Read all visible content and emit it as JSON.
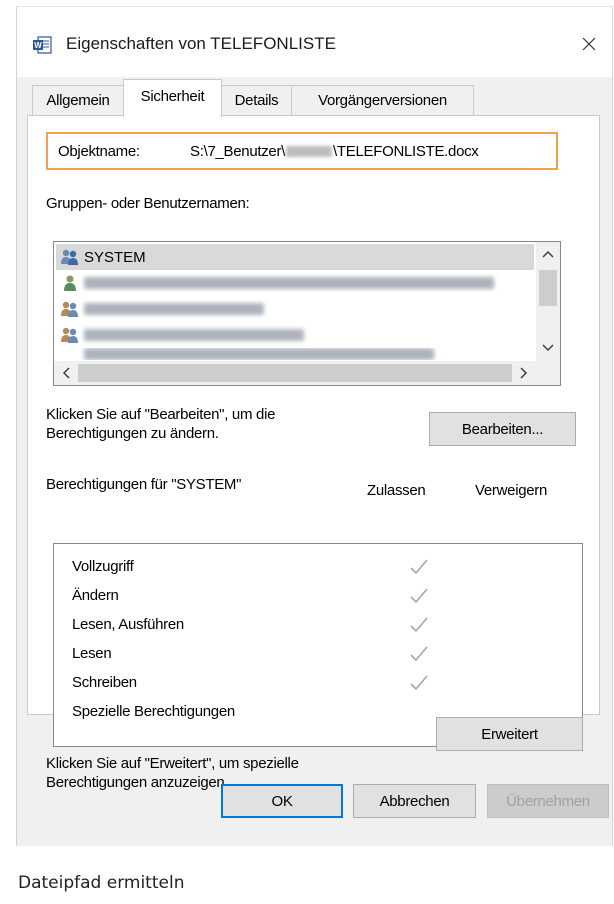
{
  "window": {
    "title": "Eigenschaften von TELEFONLISTE",
    "app_icon": "word-document-icon",
    "close_icon": "close-icon"
  },
  "tabs": [
    {
      "label": "Allgemein",
      "active": false
    },
    {
      "label": "Sicherheit",
      "active": true
    },
    {
      "label": "Details",
      "active": false
    },
    {
      "label": "Vorgängerversionen",
      "active": false
    }
  ],
  "object": {
    "label": "Objektname:",
    "path_prefix": "S:\\7_Benutzer\\",
    "path_suffix": "\\TELEFONLISTE.docx"
  },
  "groups": {
    "label": "Gruppen- oder Benutzernamen:",
    "items": [
      {
        "name": "SYSTEM",
        "selected": true
      }
    ]
  },
  "edit": {
    "text_line1": "Klicken Sie auf \"Bearbeiten\", um die",
    "text_line2": "Berechtigungen zu ändern.",
    "button": "Bearbeiten..."
  },
  "permissions": {
    "header": "Berechtigungen für \"SYSTEM\"",
    "allow_label": "Zulassen",
    "deny_label": "Verweigern",
    "items": [
      {
        "name": "Vollzugriff",
        "allow": true
      },
      {
        "name": "Ändern",
        "allow": true
      },
      {
        "name": "Lesen, Ausführen",
        "allow": true
      },
      {
        "name": "Lesen",
        "allow": true
      },
      {
        "name": "Schreiben",
        "allow": true
      },
      {
        "name": "Spezielle Berechtigungen",
        "allow": false
      }
    ]
  },
  "advanced": {
    "text_line1": "Klicken Sie auf \"Erweitert\", um spezielle",
    "text_line2": "Berechtigungen anzuzeigen.",
    "button": "Erweitert"
  },
  "buttons": {
    "ok": "OK",
    "cancel": "Abbrechen",
    "apply": "Übernehmen"
  },
  "caption": "Dateipfad ermitteln",
  "colors": {
    "highlight_border": "#f0a44a",
    "check_mark": "#a6a6a6",
    "selection": "#d9d9d9"
  }
}
